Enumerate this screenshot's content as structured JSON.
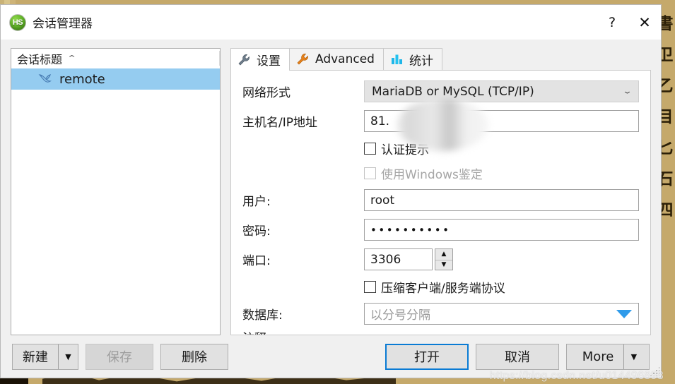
{
  "window": {
    "title": "会话管理器",
    "app_icon": "heidisql-logo-icon",
    "icon_text": "HS",
    "help_label": "?",
    "close_label": "✕"
  },
  "session_list": {
    "header": "会话标题",
    "sort_indicator": "⌃",
    "items": [
      {
        "label": "remote",
        "icon": "dolphin-icon",
        "selected": true
      }
    ]
  },
  "tabs": [
    {
      "label": "设置",
      "icon": "wrench-gray-icon",
      "active": true
    },
    {
      "label": "Advanced",
      "icon": "wrench-orange-icon",
      "active": false
    },
    {
      "label": "统计",
      "icon": "bar-chart-icon",
      "active": false
    }
  ],
  "settings_form": {
    "network_type": {
      "label": "网络形式",
      "value": "MariaDB or MySQL (TCP/IP)",
      "chevron": "⌄"
    },
    "hostname": {
      "label": "主机名/IP地址",
      "value": "81.",
      "redacted": true
    },
    "prompt_credentials": {
      "label": "认证提示",
      "checked": false,
      "enabled": true
    },
    "windows_auth": {
      "label": "使用Windows鉴定",
      "checked": false,
      "enabled": false
    },
    "user": {
      "label": "用户:",
      "value": "root"
    },
    "password": {
      "label": "密码:",
      "value": "••••••••••"
    },
    "port": {
      "label": "端口:",
      "value": "3306",
      "spin_up": "▲",
      "spin_down": "▼"
    },
    "compressed_protocol": {
      "label": "压缩客户端/服务端协议",
      "checked": false,
      "enabled": true
    },
    "databases": {
      "label": "数据库:",
      "value": "",
      "placeholder": "以分号分隔",
      "dropdown_icon": "dropdown-triangle-icon"
    },
    "comment": {
      "label": "注释:"
    }
  },
  "buttons": {
    "new": {
      "label": "新建",
      "arrow": "▼",
      "enabled": true
    },
    "save": {
      "label": "保存",
      "enabled": false
    },
    "delete": {
      "label": "删除",
      "enabled": true
    },
    "open": {
      "label": "打开",
      "default": true
    },
    "cancel": {
      "label": "取消"
    },
    "more": {
      "label": "More",
      "arrow": "▼"
    }
  },
  "watermark": "https://blog.csdn.net/u014496898",
  "background": {
    "characters": [
      "書",
      "卫",
      "乙",
      "目",
      "匕",
      "石",
      "四"
    ]
  },
  "colors": {
    "selection_blue": "#95ccf0",
    "default_button_border": "#0a7bd4",
    "dropdown_blue": "#2f9bea",
    "desktop_tan": "#c9b277"
  }
}
